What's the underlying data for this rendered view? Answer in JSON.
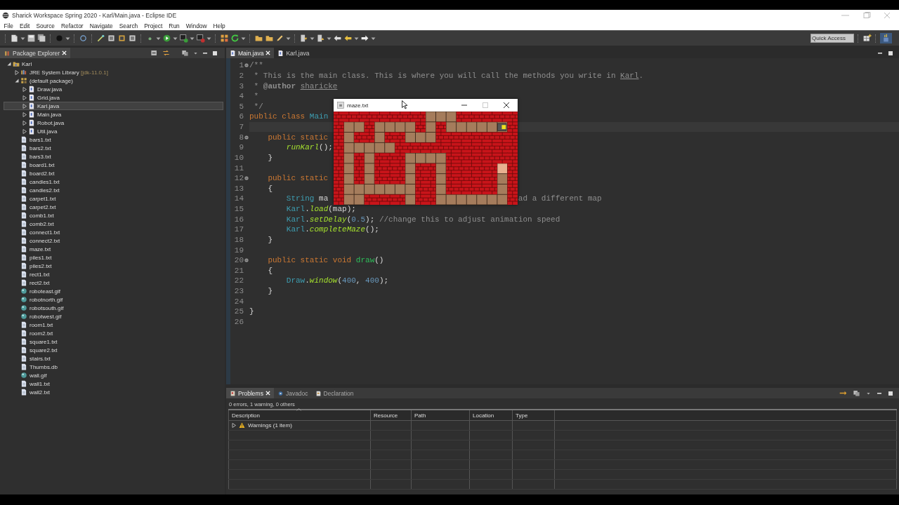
{
  "window": {
    "title": "Sharick Workspace Spring 2020 - Karl/Main.java - Eclipse IDE"
  },
  "menu": [
    "File",
    "Edit",
    "Source",
    "Refactor",
    "Navigate",
    "Search",
    "Project",
    "Run",
    "Window",
    "Help"
  ],
  "quick_access": {
    "placeholder": "Quick Access"
  },
  "package_explorer": {
    "tab": {
      "label": "Package Explorer",
      "selected": true
    },
    "tree": [
      {
        "kind": "project",
        "label": "Karl",
        "expanded": true,
        "selected": false,
        "children": [
          {
            "kind": "library",
            "label": "JRE System Library",
            "decoration": "[jdk-11.0.1]",
            "expanded": false,
            "selected": false
          },
          {
            "kind": "package",
            "label": "(default package)",
            "expanded": true,
            "selected": false,
            "children": [
              {
                "kind": "java",
                "label": "Draw.java",
                "expanded": false,
                "selected": false
              },
              {
                "kind": "java",
                "label": "Grid.java",
                "expanded": false,
                "selected": false
              },
              {
                "kind": "java",
                "label": "Karl.java",
                "expanded": false,
                "selected": true
              },
              {
                "kind": "java",
                "label": "Main.java",
                "expanded": false,
                "selected": false
              },
              {
                "kind": "java",
                "label": "Robot.java",
                "expanded": false,
                "selected": false
              },
              {
                "kind": "java",
                "label": "Util.java",
                "expanded": false,
                "selected": false
              }
            ]
          },
          {
            "kind": "txt",
            "label": "bars1.txt",
            "selected": false
          },
          {
            "kind": "txt",
            "label": "bars2.txt",
            "selected": false
          },
          {
            "kind": "txt",
            "label": "bars3.txt",
            "selected": false
          },
          {
            "kind": "txt",
            "label": "board1.txt",
            "selected": false
          },
          {
            "kind": "txt",
            "label": "board2.txt",
            "selected": false
          },
          {
            "kind": "txt",
            "label": "candles1.txt",
            "selected": false
          },
          {
            "kind": "txt",
            "label": "candles2.txt",
            "selected": false
          },
          {
            "kind": "txt",
            "label": "carpet1.txt",
            "selected": false
          },
          {
            "kind": "txt",
            "label": "carpet2.txt",
            "selected": false
          },
          {
            "kind": "txt",
            "label": "comb1.txt",
            "selected": false
          },
          {
            "kind": "txt",
            "label": "comb2.txt",
            "selected": false
          },
          {
            "kind": "txt",
            "label": "connect1.txt",
            "selected": false
          },
          {
            "kind": "txt",
            "label": "connect2.txt",
            "selected": false
          },
          {
            "kind": "txt",
            "label": "maze.txt",
            "selected": false
          },
          {
            "kind": "txt",
            "label": "piles1.txt",
            "selected": false
          },
          {
            "kind": "txt",
            "label": "piles2.txt",
            "selected": false
          },
          {
            "kind": "txt",
            "label": "rect1.txt",
            "selected": false
          },
          {
            "kind": "txt",
            "label": "rect2.txt",
            "selected": false
          },
          {
            "kind": "gif",
            "label": "roboteast.gif",
            "selected": false
          },
          {
            "kind": "gif",
            "label": "robotnorth.gif",
            "selected": false
          },
          {
            "kind": "gif",
            "label": "robotsouth.gif",
            "selected": false
          },
          {
            "kind": "gif",
            "label": "robotwest.gif",
            "selected": false
          },
          {
            "kind": "txt",
            "label": "room1.txt",
            "selected": false
          },
          {
            "kind": "txt",
            "label": "room2.txt",
            "selected": false
          },
          {
            "kind": "txt",
            "label": "square1.txt",
            "selected": false
          },
          {
            "kind": "txt",
            "label": "square2.txt",
            "selected": false
          },
          {
            "kind": "txt",
            "label": "stairs.txt",
            "selected": false
          },
          {
            "kind": "db",
            "label": "Thumbs.db",
            "selected": false
          },
          {
            "kind": "gif",
            "label": "wall.gif",
            "selected": false
          },
          {
            "kind": "txt",
            "label": "wall1.txt",
            "selected": false
          },
          {
            "kind": "txt",
            "label": "wall2.txt",
            "selected": false
          }
        ]
      }
    ]
  },
  "editor": {
    "tabs": [
      {
        "label": "Main.java",
        "selected": true,
        "closable": true
      },
      {
        "label": "Karl.java",
        "selected": false,
        "closable": false
      }
    ],
    "lines": [
      {
        "number": "1",
        "fold": true,
        "current": false,
        "tokens": [
          {
            "kind": "comment",
            "text": "/**"
          }
        ]
      },
      {
        "number": "2",
        "fold": false,
        "current": false,
        "tokens": [
          {
            "kind": "comment",
            "text": " * This is the main class. This is where you will call the methods you write in "
          },
          {
            "kind": "misspelled",
            "text": "Karl"
          },
          {
            "kind": "comment",
            "text": "."
          }
        ]
      },
      {
        "number": "3",
        "fold": false,
        "current": false,
        "tokens": [
          {
            "kind": "comment",
            "text": " * "
          },
          {
            "kind": "doc_tag",
            "text": "@author "
          },
          {
            "kind": "misspelled",
            "text": "sharicke"
          }
        ]
      },
      {
        "number": "4",
        "fold": false,
        "current": false,
        "tokens": [
          {
            "kind": "comment",
            "text": " *"
          }
        ]
      },
      {
        "number": "5",
        "fold": false,
        "current": false,
        "tokens": [
          {
            "kind": "comment",
            "text": " */"
          }
        ]
      },
      {
        "number": "6",
        "fold": false,
        "current": false,
        "tokens": [
          {
            "kind": "keyword",
            "text": "public class "
          },
          {
            "kind": "type",
            "text": "Main"
          }
        ]
      },
      {
        "number": "7",
        "fold": false,
        "current": true
      },
      {
        "number": "8",
        "fold": true,
        "current": false,
        "tokens": [
          {
            "kind": "keyword",
            "text": "    public static"
          }
        ]
      },
      {
        "number": "9",
        "fold": false,
        "current": false,
        "tokens": [
          {
            "kind": "method",
            "text": "        runKarl"
          },
          {
            "kind": "plain",
            "text": "();"
          }
        ]
      },
      {
        "number": "10",
        "fold": false,
        "current": false,
        "tokens": [
          {
            "kind": "plain",
            "text": "    }"
          }
        ]
      },
      {
        "number": "11",
        "fold": false,
        "current": false
      },
      {
        "number": "12",
        "fold": true,
        "current": false,
        "tokens": [
          {
            "kind": "keyword",
            "text": "    public static"
          }
        ]
      },
      {
        "number": "13",
        "fold": false,
        "current": false,
        "tokens": [
          {
            "kind": "plain",
            "text": "    {"
          }
        ]
      },
      {
        "number": "14",
        "fold": false,
        "current": false,
        "tokens": [
          {
            "kind": "type",
            "text": "        String "
          },
          {
            "kind": "plain",
            "text": "ma"
          }
        ],
        "after": [
          {
            "kind": "comment",
            "text": "ad a different map"
          }
        ]
      },
      {
        "number": "15",
        "fold": false,
        "current": false,
        "tokens": [
          {
            "kind": "type",
            "text": "        Karl"
          },
          {
            "kind": "plain",
            "text": "."
          },
          {
            "kind": "method",
            "text": "load"
          },
          {
            "kind": "plain",
            "text": "(map);"
          }
        ]
      },
      {
        "number": "16",
        "fold": false,
        "current": false,
        "tokens": [
          {
            "kind": "type",
            "text": "        Karl"
          },
          {
            "kind": "plain",
            "text": "."
          },
          {
            "kind": "method",
            "text": "setDelay"
          },
          {
            "kind": "plain",
            "text": "("
          },
          {
            "kind": "number",
            "text": "0.5"
          },
          {
            "kind": "plain",
            "text": "); "
          },
          {
            "kind": "comment",
            "text": "//change this to adjust animation speed"
          }
        ]
      },
      {
        "number": "17",
        "fold": false,
        "current": false,
        "tokens": [
          {
            "kind": "type",
            "text": "        Karl"
          },
          {
            "kind": "plain",
            "text": "."
          },
          {
            "kind": "method",
            "text": "completeMaze"
          },
          {
            "kind": "plain",
            "text": "();"
          }
        ]
      },
      {
        "number": "18",
        "fold": false,
        "current": false,
        "tokens": [
          {
            "kind": "plain",
            "text": "    }"
          }
        ]
      },
      {
        "number": "19",
        "fold": false,
        "current": false
      },
      {
        "number": "20",
        "fold": true,
        "current": false,
        "tokens": [
          {
            "kind": "keyword",
            "text": "    public static void "
          },
          {
            "kind": "declaration",
            "text": "draw"
          },
          {
            "kind": "plain",
            "text": "()"
          }
        ]
      },
      {
        "number": "21",
        "fold": false,
        "current": false,
        "tokens": [
          {
            "kind": "plain",
            "text": "    {"
          }
        ]
      },
      {
        "number": "22",
        "fold": false,
        "current": false,
        "tokens": [
          {
            "kind": "type",
            "text": "        Draw"
          },
          {
            "kind": "plain",
            "text": "."
          },
          {
            "kind": "method",
            "text": "window"
          },
          {
            "kind": "plain",
            "text": "("
          },
          {
            "kind": "number",
            "text": "400"
          },
          {
            "kind": "plain",
            "text": ", "
          },
          {
            "kind": "number",
            "text": "400"
          },
          {
            "kind": "plain",
            "text": ");"
          }
        ]
      },
      {
        "number": "23",
        "fold": false,
        "current": false,
        "tokens": [
          {
            "kind": "plain",
            "text": "    }"
          }
        ]
      },
      {
        "number": "24",
        "fold": false,
        "current": false
      },
      {
        "number": "25",
        "fold": false,
        "current": false,
        "tokens": [
          {
            "kind": "plain",
            "text": "}"
          }
        ]
      },
      {
        "number": "26",
        "fold": false,
        "current": false
      }
    ]
  },
  "problems": {
    "tabs": [
      {
        "kind": "problems",
        "label": "Problems",
        "selected": true,
        "closable": true
      },
      {
        "kind": "javadoc",
        "label": "Javadoc",
        "selected": false,
        "closable": false
      },
      {
        "kind": "declaration",
        "label": "Declaration",
        "selected": false,
        "closable": false
      }
    ],
    "summary": "0 errors, 1 warning, 0 others",
    "columns": [
      "Description",
      "Resource",
      "Path",
      "Location",
      "Type"
    ],
    "rows": [
      {
        "kind": "warning_group",
        "label": "Warnings (1 item)",
        "expanded": false
      }
    ]
  },
  "maze_window": {
    "title": "maze.txt"
  }
}
